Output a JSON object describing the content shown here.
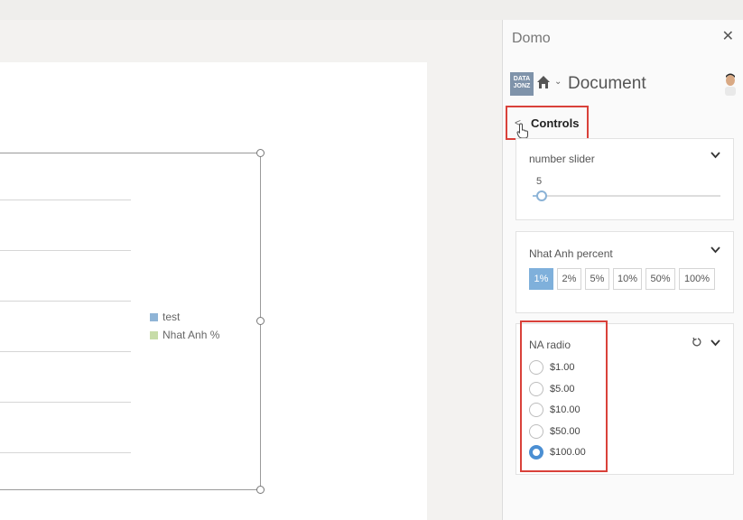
{
  "panel": {
    "title": "Domo",
    "close_glyph": "✕",
    "logo_text_top": "DATA",
    "logo_text_bottom": "JONZ",
    "document_title": "Document",
    "controls_label": "Controls",
    "back_glyph": "<",
    "icons": [
      "close-icon",
      "home-icon",
      "chevron-down-icon",
      "avatar",
      "back-arrow-icon",
      "hand-pointer-icon",
      "reset-icon"
    ]
  },
  "chart": {
    "legend": [
      {
        "label": "test",
        "color": "#8fb4d6"
      },
      {
        "label": "Nhat Anh %",
        "color": "#c7dca8"
      }
    ]
  },
  "controls": {
    "slider": {
      "title": "number slider",
      "value": "5",
      "fraction": 0.05
    },
    "percent": {
      "title": "Nhat Anh percent",
      "options": [
        "1%",
        "2%",
        "5%",
        "10%",
        "50%",
        "100%"
      ],
      "selected": "1%"
    },
    "radio": {
      "title": "NA radio",
      "options": [
        "$1.00",
        "$5.00",
        "$10.00",
        "$50.00",
        "$100.00"
      ],
      "selected": "$100.00"
    }
  },
  "colors": {
    "accent": "#7fb0db",
    "radio_checked": "#4b8fd3",
    "highlight": "#d9413a"
  }
}
